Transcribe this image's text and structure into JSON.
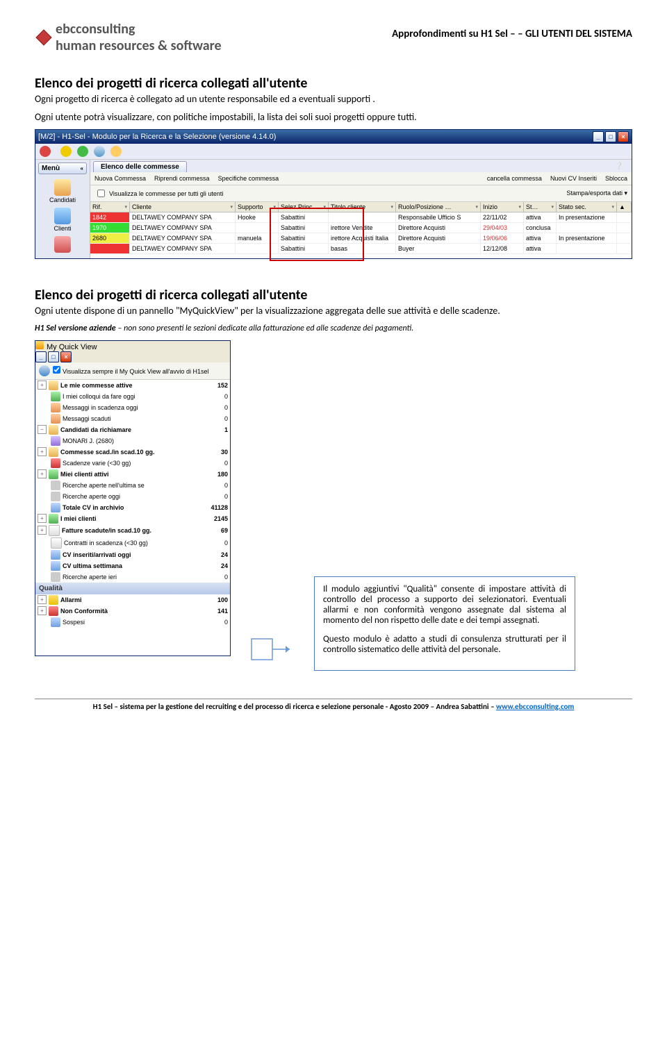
{
  "header": {
    "logo_text": "ebcconsulting",
    "logo_sub": "human resources & software",
    "title": "Approfondimenti su H1 Sel – – GLI UTENTI DEL SISTEMA"
  },
  "section1": {
    "title": "Elenco dei progetti di ricerca collegati all'utente",
    "body1": "Ogni progetto di ricerca è collegato ad un utente responsabile ed a eventuali supporti .",
    "body2": "Ogni utente potrà visualizzare, con politiche impostabili, la lista dei soli suoi progetti oppure tutti."
  },
  "win1": {
    "title": "[M/2] - H1-Sel - Modulo per la Ricerca e la Selezione (versione 4.14.0)",
    "menu_label": "Menù",
    "sidebar": [
      {
        "label": "Candidati",
        "cls": "cand"
      },
      {
        "label": "Clienti",
        "cls": "cli"
      },
      {
        "label": "",
        "cls": "rpt"
      }
    ],
    "tab_label": "Elenco delle commesse",
    "toolbar_items": [
      "Nuova Commessa",
      "Riprendi commessa",
      "Specifiche commessa",
      "cancella commessa",
      "Nuovi CV Inseriti",
      "Sblocca"
    ],
    "checkbox_label": "Visualizza le commesse per tutti gli utenti",
    "print_export": "Stampa/esporta dati ▾",
    "columns": [
      "Rif.",
      "Cliente",
      "Supporto",
      "Selez.Princ.",
      "Titolo cliente",
      "Ruolo/Posizione …",
      "Inizio",
      "St…",
      "Stato sec."
    ],
    "rows": [
      {
        "cls": "rr1",
        "rif": "1842",
        "cliente": "DELTAWEY COMPANY SPA",
        "supporto": "Hooke",
        "selez": "Sabattini",
        "titolo": "",
        "ruolo": "Responsabile Ufficio S",
        "inizio": "22/11/02",
        "st": "attiva",
        "stsec": "In presentazione"
      },
      {
        "cls": "rr2",
        "rif": "1970",
        "cliente": "DELTAWEY COMPANY SPA",
        "supporto": "",
        "selez": "Sabattini",
        "titolo": "irettore Vendite",
        "ruolo": "Direttore Acquisti",
        "inizio": "29/04/03",
        "st": "conclusa",
        "stsec": ""
      },
      {
        "cls": "rr3",
        "rif": "2680",
        "cliente": "DELTAWEY COMPANY SPA",
        "supporto": "manuela",
        "selez": "Sabattini",
        "titolo": "irettore Acquisti Italia",
        "ruolo": "Direttore Acquisti",
        "inizio": "19/06/06",
        "st": "attiva",
        "stsec": "In presentazione"
      },
      {
        "cls": "rr4",
        "rif": "",
        "cliente": "DELTAWEY COMPANY SPA",
        "supporto": "",
        "selez": "Sabattini",
        "titolo": "basas",
        "ruolo": "Buyer",
        "inizio": "12/12/08",
        "st": "attiva",
        "stsec": ""
      }
    ]
  },
  "section2": {
    "title": "Elenco dei progetti di ricerca collegati all'utente",
    "body": "Ogni utente dispone di un pannello \"MyQuickView\" per la visualizzazione aggregata delle sue attività e delle scadenze.",
    "note_bold": "H1 Sel versione aziende",
    "note_rest": " – non sono presenti le sezioni dedicate alla fatturazione ed alle scadenze dei pagamenti."
  },
  "mqv": {
    "title": "My Quick View",
    "checkbox_label": "Visualizza sempre il My Quick View all'avvio di H1sel",
    "items": [
      {
        "exp": "+",
        "bold": true,
        "ico": "folder",
        "label": "Le mie commesse attive",
        "val": "152"
      },
      {
        "exp": "",
        "ico": "people",
        "label": "I miei colloqui da fare oggi",
        "val": "0",
        "indent": true
      },
      {
        "exp": "",
        "ico": "msg",
        "label": "Messaggi in scadenza oggi",
        "val": "0",
        "indent": true
      },
      {
        "exp": "",
        "ico": "msg",
        "label": "Messaggi scaduti",
        "val": "0",
        "indent": true
      },
      {
        "exp": "−",
        "bold": true,
        "ico": "folder",
        "label": "Candidati da richiamare",
        "val": "1"
      },
      {
        "exp": "",
        "ico": "head",
        "label": "MONARI J. (2680)",
        "val": "",
        "indent": true
      },
      {
        "exp": "+",
        "bold": true,
        "ico": "folder",
        "label": "Commesse scad./in scad.10 gg.",
        "val": "30"
      },
      {
        "exp": "",
        "ico": "xred",
        "label": "Scadenze varie (<30 gg)",
        "val": "0",
        "indent": true
      },
      {
        "exp": "+",
        "bold": true,
        "ico": "people",
        "label": "Miei clienti attivi",
        "val": "180"
      },
      {
        "exp": "",
        "ico": "grey",
        "label": "Ricerche aperte nell'ultima se",
        "val": "0",
        "indent": true
      },
      {
        "exp": "",
        "ico": "grey",
        "label": "Ricerche aperte oggi",
        "val": "0",
        "indent": true
      },
      {
        "exp": "",
        "bold": true,
        "ico": "blue",
        "label": "Totale CV in archivio",
        "val": "41128",
        "indent": true
      },
      {
        "exp": "+",
        "bold": true,
        "ico": "people",
        "label": "I miei clienti",
        "val": "2145"
      },
      {
        "exp": "+",
        "bold": true,
        "ico": "paper",
        "label": "Fatture scadute/in scad.10 gg.",
        "val": "69"
      },
      {
        "exp": "",
        "ico": "paper",
        "label": "Contratti in scadenza (<30 gg)",
        "val": "0",
        "indent": true
      },
      {
        "exp": "",
        "bold": true,
        "ico": "blue",
        "label": "CV inseriti/arrivati oggi",
        "val": "24",
        "indent": true
      },
      {
        "exp": "",
        "bold": true,
        "ico": "blue",
        "label": "CV ultima settimana",
        "val": "24",
        "indent": true
      },
      {
        "exp": "",
        "ico": "grey",
        "label": "Ricerche aperte ieri",
        "val": "0",
        "indent": true
      }
    ],
    "qualita_header": "Qualità",
    "qualita_items": [
      {
        "exp": "+",
        "ico": "warn",
        "label": "Allarmi",
        "val": "100",
        "bold": true
      },
      {
        "exp": "+",
        "ico": "xred",
        "label": "Non Conformità",
        "val": "141",
        "bold": true
      },
      {
        "exp": "",
        "ico": "blue",
        "label": "Sospesi",
        "val": "0",
        "indent": true
      }
    ]
  },
  "infobox": {
    "p1": "Il modulo aggiuntivi \"Qualità\" consente di impostare attività di controllo del processo a supporto dei selezionatori. Eventuali allarmi e non conformità vengono assegnate dal sistema al momento del non rispetto delle date e dei tempi assegnati.",
    "p2": "Questo modulo è adatto a studi di consulenza strutturati per il controllo sistematico delle attività del personale."
  },
  "footer": {
    "text": "H1 Sel – sistema per la gestione del recruiting e del processo di ricerca e selezione personale  -  Agosto 2009 – Andrea Sabattini – ",
    "link": "www.ebcconsulting.com"
  }
}
